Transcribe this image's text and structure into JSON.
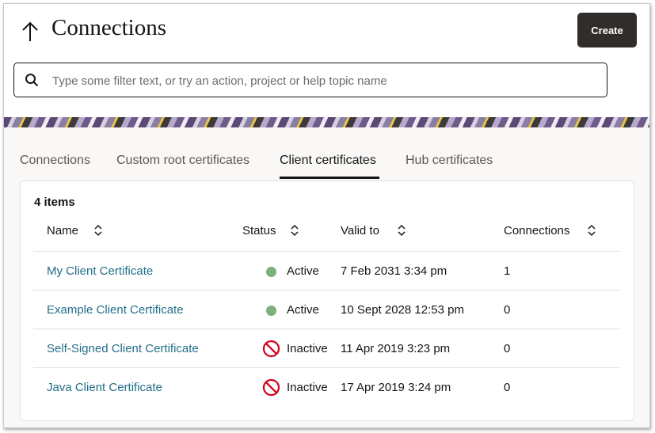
{
  "header": {
    "title": "Connections",
    "back_icon": "arrow-up-icon",
    "create_label": "Create"
  },
  "search": {
    "placeholder": "Type some filter text, or try an action, project or help topic name",
    "value": ""
  },
  "tabs": [
    {
      "label": "Connections",
      "active": false
    },
    {
      "label": "Custom root certificates",
      "active": false
    },
    {
      "label": "Client certificates",
      "active": true
    },
    {
      "label": "Hub certificates",
      "active": false
    }
  ],
  "table": {
    "count_label": "4 items",
    "columns": [
      "Name",
      "Status",
      "Valid to",
      "Connections"
    ],
    "rows": [
      {
        "name": "My Client Certificate",
        "status": "Active",
        "valid_to": "7 Feb 2031 3:34 pm",
        "connections": "1"
      },
      {
        "name": "Example Client Certificate",
        "status": "Active",
        "valid_to": "10 Sept 2028 12:53 pm",
        "connections": "0"
      },
      {
        "name": "Self-Signed Client Certificate",
        "status": "Inactive",
        "valid_to": "11 Apr 2019 3:23 pm",
        "connections": "0"
      },
      {
        "name": "Java Client Certificate",
        "status": "Inactive",
        "valid_to": "17 Apr 2019 3:24 pm",
        "connections": "0"
      }
    ]
  },
  "colors": {
    "accent_dark": "#312d2a",
    "link": "#226e8a",
    "active_status": "#7bb07c",
    "inactive_status": "#d0021b"
  }
}
